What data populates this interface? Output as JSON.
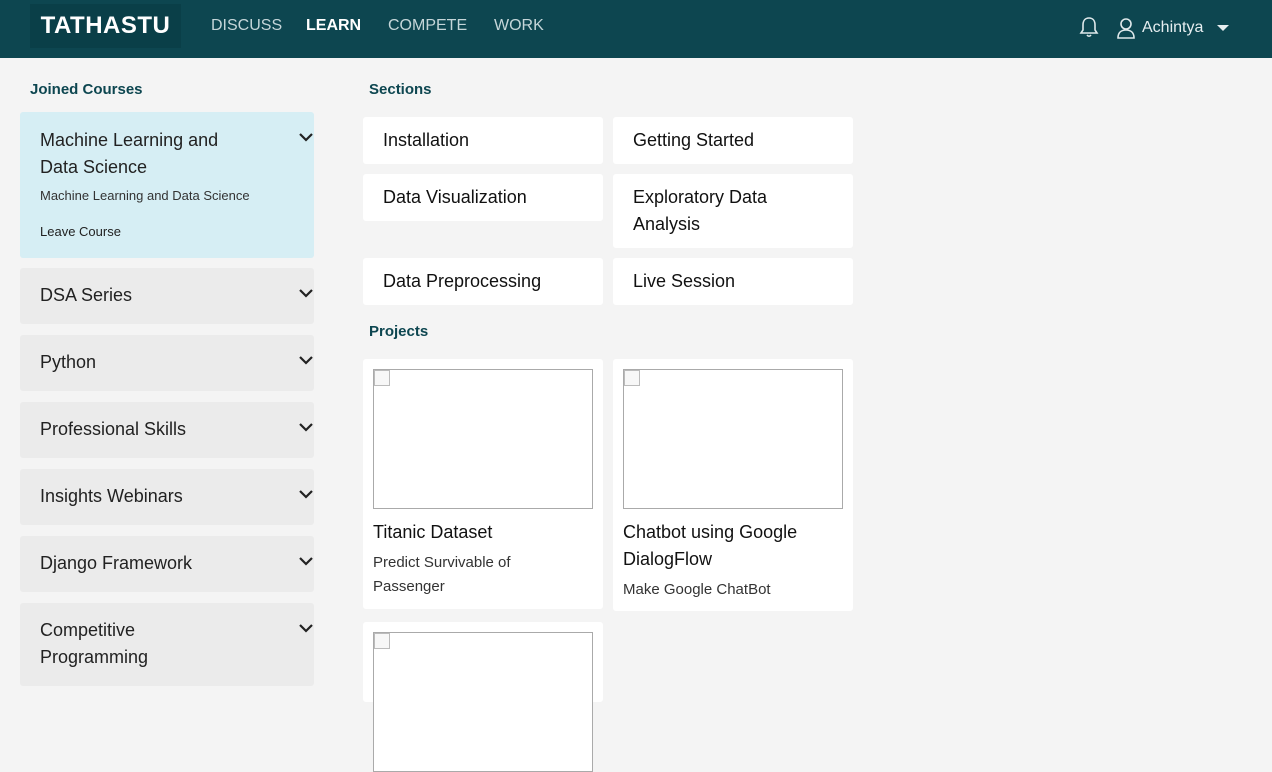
{
  "brand": "TATHASTU",
  "nav": {
    "discuss": "DISCUSS",
    "learn": "LEARN",
    "compete": "COMPETE",
    "work": "WORK"
  },
  "user": {
    "name": "Achintya"
  },
  "sidebar": {
    "title": "Joined Courses",
    "active_course": {
      "name": "Machine Learning and Data Science",
      "subtitle": "Machine Learning and Data Science",
      "leave_label": "Leave Course"
    },
    "courses": [
      "DSA Series",
      "Python",
      "Professional Skills",
      "Insights Webinars",
      "Django Framework",
      "Competitive Programming"
    ]
  },
  "sections": {
    "title": "Sections",
    "items": [
      "Installation",
      "Getting Started",
      "Data Visualization",
      "Exploratory Data Analysis",
      "Data Preprocessing",
      "Live Session"
    ]
  },
  "projects": {
    "title": "Projects",
    "items": [
      {
        "name": "Titanic Dataset",
        "description": "Predict Survivable of Passenger"
      },
      {
        "name": "Chatbot using Google DialogFlow",
        "description": "Make Google ChatBot"
      }
    ]
  },
  "colors": {
    "navbar": "#0d4650",
    "active_course_bg": "#d6eef4",
    "course_bg": "#ebebeb",
    "heading": "#0d4650"
  },
  "icons": [
    "notification-bell-icon",
    "user-icon",
    "caret-down-icon",
    "chevron-down-icon",
    "broken-image-icon"
  ]
}
